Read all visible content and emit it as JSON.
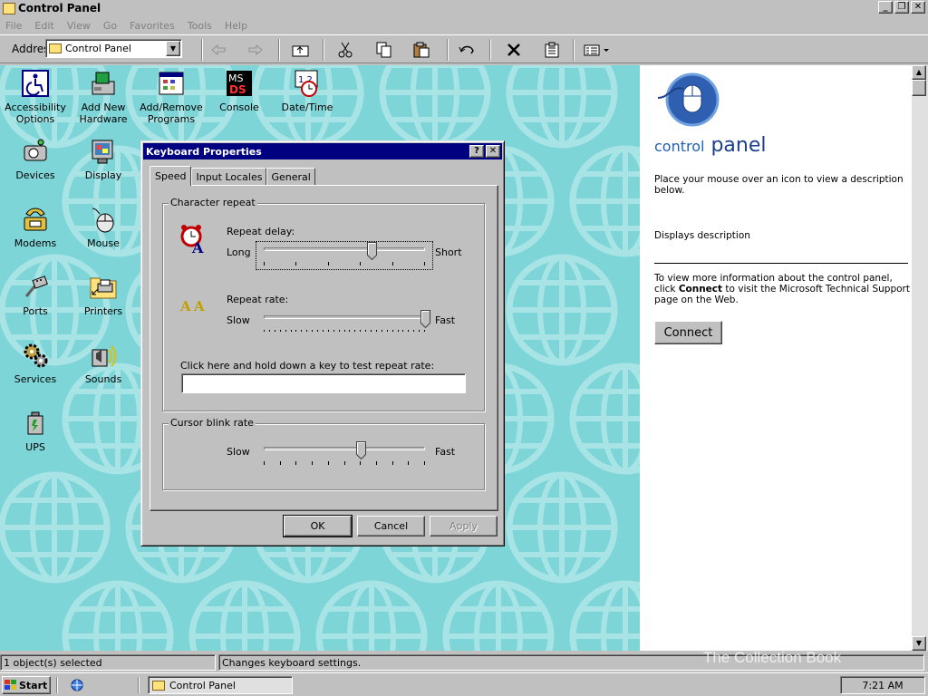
{
  "window": {
    "title": "Control Panel"
  },
  "menu": [
    "File",
    "Edit",
    "View",
    "Go",
    "Favorites",
    "Tools",
    "Help"
  ],
  "address": {
    "label": "Addres",
    "value": "Control Panel"
  },
  "toolbar_icons": [
    "back-icon",
    "forward-icon",
    "up-folder-icon",
    "cut-icon",
    "copy-icon",
    "paste-icon",
    "undo-icon",
    "delete-icon",
    "properties-icon",
    "views-icon"
  ],
  "icons": [
    {
      "name": "accessibility-options",
      "label": "Accessibility Options",
      "icon": "accessibility-icon"
    },
    {
      "name": "add-new-hardware",
      "label": "Add New Hardware",
      "icon": "hardware-icon"
    },
    {
      "name": "add-remove-programs",
      "label": "Add/Remove Programs",
      "icon": "programs-icon"
    },
    {
      "name": "console",
      "label": "Console",
      "icon": "console-icon"
    },
    {
      "name": "date-time",
      "label": "Date/Time",
      "icon": "clock-icon"
    },
    {
      "name": "devices",
      "label": "Devices",
      "icon": "devices-icon"
    },
    {
      "name": "display",
      "label": "Display",
      "icon": "monitor-icon"
    },
    {
      "name": "modems",
      "label": "Modems",
      "icon": "modem-icon"
    },
    {
      "name": "mouse",
      "label": "Mouse",
      "icon": "mouse-icon"
    },
    {
      "name": "ports",
      "label": "Ports",
      "icon": "port-icon"
    },
    {
      "name": "printers",
      "label": "Printers",
      "icon": "printer-icon"
    },
    {
      "name": "services",
      "label": "Services",
      "icon": "gears-icon"
    },
    {
      "name": "sounds",
      "label": "Sounds",
      "icon": "speaker-icon"
    },
    {
      "name": "ups",
      "label": "UPS",
      "icon": "battery-icon"
    }
  ],
  "right_pane": {
    "title_small": "control",
    "title_big": "panel",
    "intro": "Place your mouse over an icon to view a description below.",
    "description": "Displays description",
    "more_info_1": "To view more information about the control panel, click ",
    "more_info_bold": "Connect",
    "more_info_2": " to visit the Microsoft Technical Support page on the Web.",
    "connect_label": "Connect"
  },
  "dialog": {
    "title": "Keyboard Properties",
    "help_btn": "?",
    "close_btn": "✕",
    "tabs": [
      "Speed",
      "Input Locales",
      "General"
    ],
    "active_tab": "Speed",
    "character_repeat": {
      "group_label": "Character repeat",
      "repeat_delay_label": "Repeat delay:",
      "repeat_delay_min": "Long",
      "repeat_delay_max": "Short",
      "repeat_delay_value": 0.67,
      "repeat_rate_label": "Repeat rate:",
      "repeat_rate_min": "Slow",
      "repeat_rate_max": "Fast",
      "repeat_rate_value": 1.0,
      "test_label": "Click here and hold down a key to test repeat rate:",
      "test_value": ""
    },
    "cursor_blink": {
      "group_label": "Cursor blink rate",
      "min": "Slow",
      "max": "Fast",
      "value": 0.6
    },
    "buttons": {
      "ok": "OK",
      "cancel": "Cancel",
      "apply": "Apply"
    }
  },
  "status": {
    "left": "1 object(s) selected",
    "right": "Changes keyboard settings."
  },
  "taskbar": {
    "start": "Start",
    "task": "Control Panel",
    "clock": "7:21 AM"
  },
  "watermark": "The Collection Book"
}
